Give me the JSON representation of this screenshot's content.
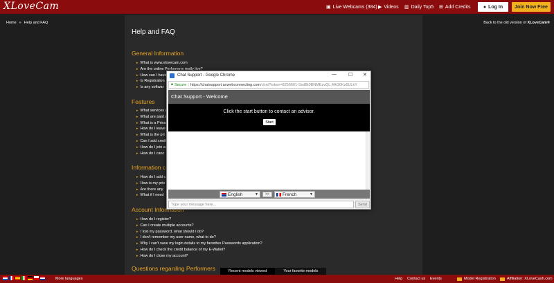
{
  "header": {
    "logo": "XLoveCam",
    "nav": [
      {
        "icon": "webcam-icon",
        "label": "Live Webcams (384)"
      },
      {
        "icon": "video-icon",
        "label": "Videos"
      },
      {
        "icon": "bar-chart-icon",
        "label": "Daily Top5"
      },
      {
        "icon": "plus-icon",
        "label": "Add Credits"
      }
    ],
    "login_label": "Log In",
    "join_label": "Join Now Free"
  },
  "breadcrumb": [
    "Home",
    "»",
    "Help and FAQ"
  ],
  "old_version": {
    "prefix": "Back to the old version of ",
    "site": "XLoveCam®"
  },
  "page_title": "Help and FAQ",
  "sections": [
    {
      "title": "General Information",
      "items": [
        "What is www.xlovecam.com",
        "Are the online Performers really live?",
        "How can I have",
        "Is Registration",
        "Is any softwar"
      ]
    },
    {
      "title": "Features",
      "items": [
        "What services a",
        "What are paid s",
        "What is a Priva",
        "How do I leave",
        "What is the pri",
        "Can I add credi",
        "How do I join a",
        "How do I canc"
      ]
    },
    {
      "title": "Information c",
      "items": [
        "How do I add c",
        "How is my priv",
        "Are there any",
        "What if I need"
      ]
    },
    {
      "title": "Account Information",
      "items": [
        "How do I register?",
        "Can I create multiple accounts?",
        "I lost my password, what should I do?",
        "I don't remember my user name, what to do?",
        "Why I can't save my login details to my favorites Passwords application?",
        "How do I check the credit balance of my E-Wallet?",
        "How do I close my account?"
      ]
    },
    {
      "title": "Questions regarding Performers",
      "items": []
    }
  ],
  "tabs": [
    "Recent models viewed",
    "Your favorite models"
  ],
  "footer": {
    "more_languages": "More languages",
    "links": [
      "Help",
      "Contact us",
      "Events"
    ],
    "model_registration": "Model Registration",
    "affiliation": "Affiliation: XLoveCash.com"
  },
  "chat_window": {
    "title": "Chat Support - Google Chrome",
    "secure": "Secure",
    "url_host": "https://chatsupport.acwebconnecting.com",
    "url_rest": "/chat?token=8256661-SxdBt0BNMEzvQL,4AG0Kz6ULkY",
    "header": "Chat Support - Welcome",
    "message": "Click the start button to contact an advisor.",
    "start_label": "Start",
    "lang_from": "English",
    "swap_label": ">>",
    "lang_to": "French",
    "input_placeholder": "Type your message here...",
    "send_label": "Send"
  },
  "colors": {
    "brand_red": "#8a0c0c",
    "accent_orange": "#e8a423",
    "join_yellow": "#f1b11f"
  }
}
